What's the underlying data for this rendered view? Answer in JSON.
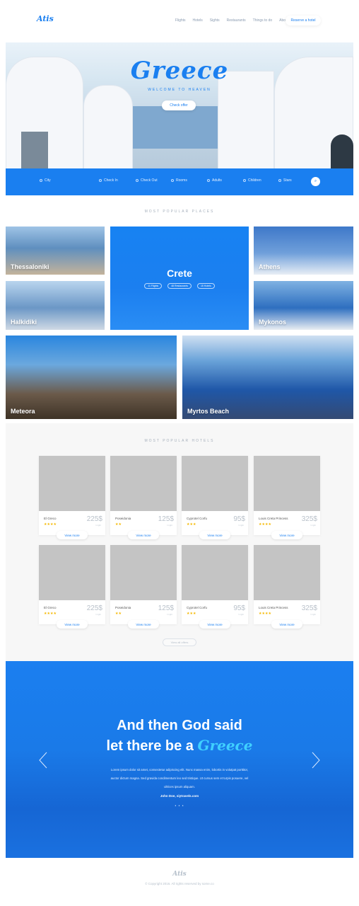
{
  "brand": {
    "logo": "Atis",
    "accent": "#1a7ff0",
    "quote_accent": "#3fd0ff"
  },
  "nav": {
    "items": [
      "Flights",
      "Hotels",
      "Sights",
      "Restaurants",
      "Things to do",
      "About Greece"
    ],
    "cta": "Reserve a hotel"
  },
  "hero": {
    "title": "Greece",
    "subtitle": "WELCOME TO HEAVEN",
    "button": "Check offer"
  },
  "search": {
    "fields": [
      "City",
      "Check In",
      "Check Out",
      "Rooms",
      "Adults",
      "Children",
      "Stars"
    ],
    "button_icon": "search-icon"
  },
  "places": {
    "section_title": "MOST POPULAR PLACES",
    "tiles": [
      "Thessaloniki",
      "Halkidiki",
      "Athens",
      "Mykonos",
      "Meteora",
      "Myrtos Beach"
    ],
    "featured": {
      "name": "Crete",
      "stats": [
        "11 Flights",
        "48 Restaurants",
        "15 Hotels"
      ]
    }
  },
  "hotels": {
    "section_title": "MOST POPULAR HOTELS",
    "price_note": "/ night",
    "view_more": "View more",
    "view_all": "View all offers",
    "cards": [
      {
        "name": "El Greco",
        "stars": "★★★★",
        "price": "225$"
      },
      {
        "name": "Poseidonia",
        "stars": "★★",
        "price": "125$"
      },
      {
        "name": "Cyprotel Corfu",
        "stars": "★★★",
        "price": "95$"
      },
      {
        "name": "Louis Creta Princess",
        "stars": "★★★★",
        "price": "325$"
      },
      {
        "name": "El Greco",
        "stars": "★★★★",
        "price": "225$"
      },
      {
        "name": "Poseidonia",
        "stars": "★★",
        "price": "125$"
      },
      {
        "name": "Cyprotel Corfu",
        "stars": "★★★",
        "price": "95$"
      },
      {
        "name": "Louis Creta Princess",
        "stars": "★★★★",
        "price": "325$"
      }
    ]
  },
  "quote": {
    "line1": "And then God said",
    "line2_pre": "let there be a",
    "line2_accent": "Greece",
    "body": "Lorem ipsum dolor sit amet, consectetur adipiscing elit. Nunc massa enim, lobortis in volutpat porttitor, auctor dictum magna. Sed gravida condimentum leo sed tristique. Ut cursus sem et turpis posuere, vel ultrices ipsum aliquam.",
    "author": "John Doe, siytravels.com",
    "dots": "• • •"
  },
  "footer": {
    "logo": "Atis",
    "copyright": "© Copyright 2016. All rights reserved by some.co"
  }
}
